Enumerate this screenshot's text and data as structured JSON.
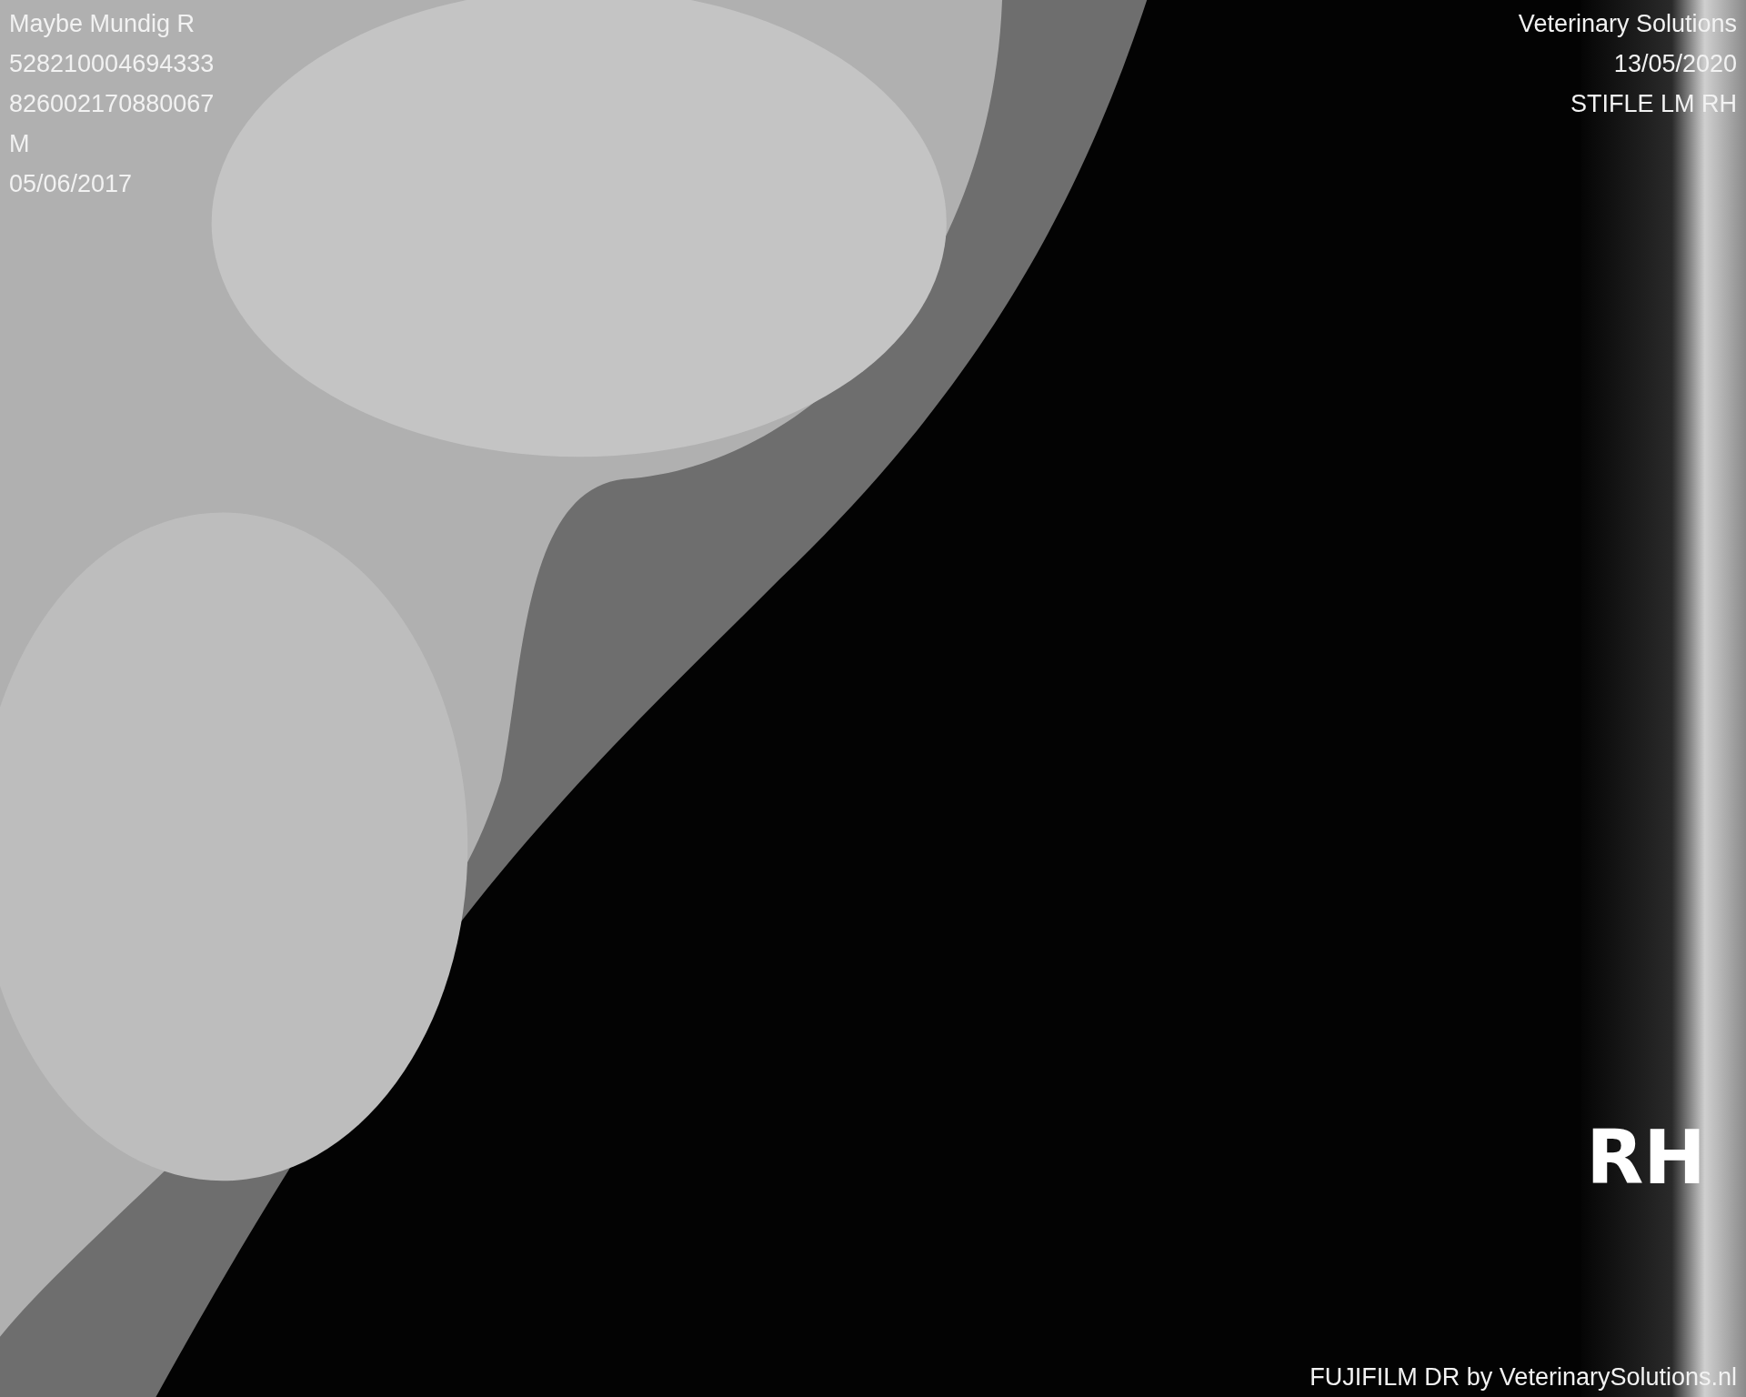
{
  "patient_info": [
    "Maybe Mundig R",
    "528210004694333",
    "826002170880067",
    "M",
    "05/06/2017"
  ],
  "study_info": [
    "Veterinary Solutions",
    "13/05/2020",
    "STIFLE LM RH"
  ],
  "side_marker": "RH",
  "footer": "FUJIFILM DR by VeterinarySolutions.nl"
}
